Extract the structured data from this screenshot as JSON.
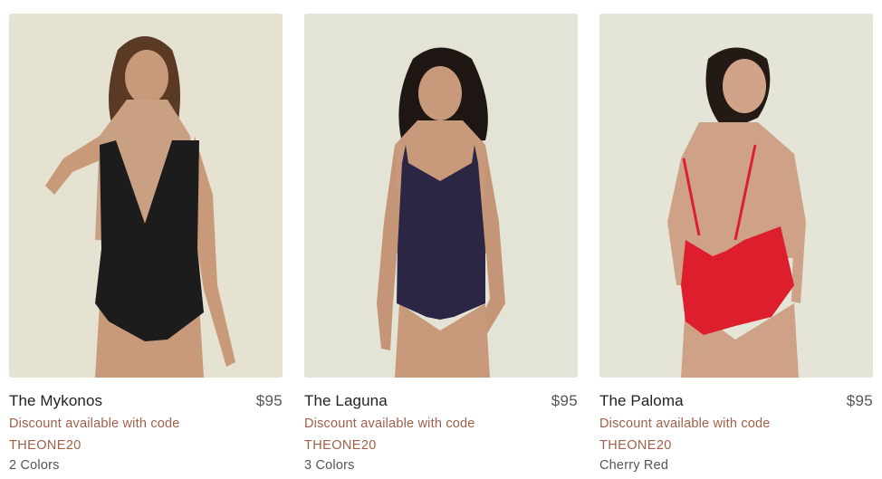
{
  "products": [
    {
      "name": "The Mykonos",
      "price": "$95",
      "discount_text": "Discount available with code",
      "code": "THEONE20",
      "colors_text": "2 Colors",
      "swimsuit_color": "#1c1c1c",
      "background_color": "#e6e2d1"
    },
    {
      "name": "The Laguna",
      "price": "$95",
      "discount_text": "Discount available with code",
      "code": "THEONE20",
      "colors_text": "3 Colors",
      "swimsuit_color": "#2c2645",
      "background_color": "#e4e4d6"
    },
    {
      "name": "The Paloma",
      "price": "$95",
      "discount_text": "Discount available with code",
      "code": "THEONE20",
      "colors_text": "Cherry Red",
      "swimsuit_color": "#dd1e2c",
      "background_color": "#e4e5d6"
    }
  ]
}
